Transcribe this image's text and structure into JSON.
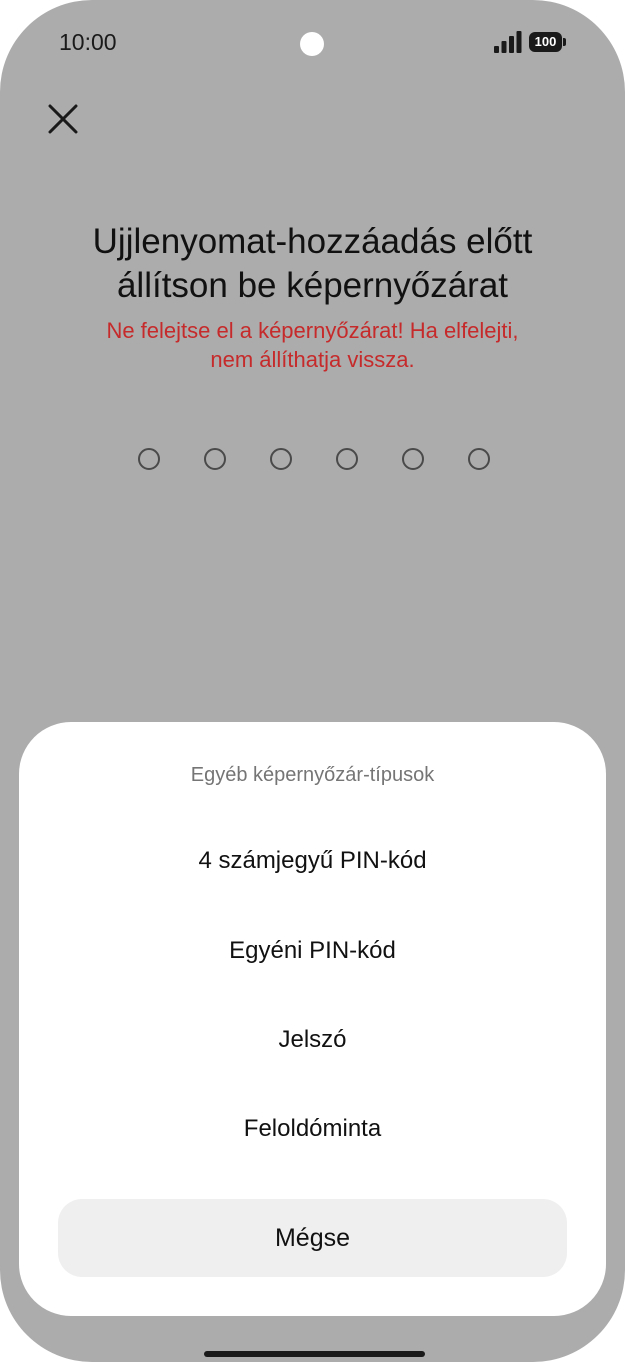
{
  "status_bar": {
    "time": "10:00",
    "battery": "100"
  },
  "header": {
    "close_icon": "close-icon"
  },
  "main": {
    "title_line1": "Ujjlenyomat-hozzáadás előtt",
    "title_line2": "állítson be képernyőzárat",
    "warning_line1": "Ne felejtse el a képernyőzárat! Ha elfelejti,",
    "warning_line2": "nem állíthatja vissza.",
    "pin_length": 6
  },
  "sheet": {
    "title": "Egyéb képernyőzár-típusok",
    "options": [
      {
        "label": "4 számjegyű PIN-kód"
      },
      {
        "label": "Egyéni PIN-kód"
      },
      {
        "label": "Jelszó"
      },
      {
        "label": "Feloldóminta"
      }
    ],
    "cancel_label": "Mégse"
  },
  "colors": {
    "backdrop": "#acacac",
    "warning": "#c62a2a",
    "sheet_bg": "#ffffff",
    "cancel_bg": "#efefef"
  }
}
